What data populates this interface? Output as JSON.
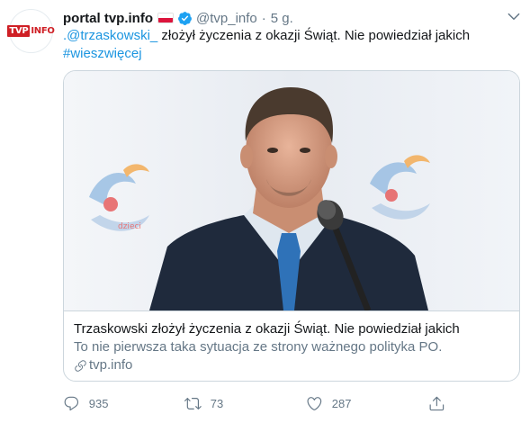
{
  "account": {
    "avatar_logo": {
      "tvp": "TVP",
      "info": "INFO"
    },
    "display_name": "portal tvp.info",
    "handle": "@tvp_info",
    "separator": "·",
    "time": "5 g.",
    "verified": true,
    "flag": "poland-flag-icon"
  },
  "tweet": {
    "mention": ".@trzaskowski_",
    "text": " złożył życzenia z okazji Świąt. Nie powiedział jakich",
    "hashtag": "#wieszwięcej"
  },
  "card": {
    "title": "Trzaskowski złożył życzenia z okazji Świąt. Nie powiedział jakich",
    "description": "To nie pierwsza taka sytuacja ze strony ważnego polityka PO.",
    "domain": "tvp.info",
    "image": "photo-of-speaker-at-microphone"
  },
  "actions": {
    "reply_count": "935",
    "retweet_count": "73",
    "like_count": "287"
  },
  "colors": {
    "link": "#1b95e0",
    "text_primary": "#14171a",
    "text_secondary": "#657786",
    "border": "#ccd6dd",
    "brand_red": "#cf1f25"
  }
}
